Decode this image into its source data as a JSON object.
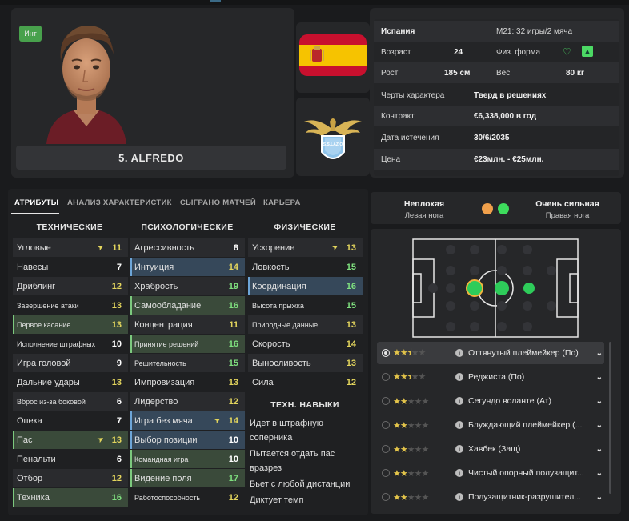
{
  "player": {
    "badge": "Инт",
    "name": "5. ALFREDO"
  },
  "info": {
    "nation": "Испания",
    "intl": "M21: 32 игры/2 мяча",
    "age_label": "Возраст",
    "age": "24",
    "form_label": "Физ. форма",
    "height_label": "Рост",
    "height": "185 см",
    "weight_label": "Вес",
    "weight": "80 кг",
    "traits_label": "Черты характера",
    "traits": "Тверд в решениях",
    "contract_label": "Контракт",
    "contract": "€6,338,000 в год",
    "expiry_label": "Дата истечения",
    "expiry": "30/6/2035",
    "value_label": "Цена",
    "value": "€23млн. - €25млн."
  },
  "club": {
    "crest_text": "S.S.LAZIO"
  },
  "tabs": [
    "АТРИБУТЫ",
    "АНАЛИЗ ХАРАКТЕРИСТИК",
    "СЫГРАНО МАТЧЕЙ",
    "КАРЬЕРА"
  ],
  "attributes": {
    "technical_title": "ТЕХНИЧЕСКИЕ",
    "mental_title": "ПСИХОЛОГИЧЕСКИЕ",
    "physical_title": "ФИЗИЧЕСКИЕ",
    "technical": [
      {
        "name": "Угловые",
        "value": "11"
      },
      {
        "name": "Навесы",
        "value": "7"
      },
      {
        "name": "Дриблинг",
        "value": "12"
      },
      {
        "name": "Завершение атаки",
        "value": "13"
      },
      {
        "name": "Первое касание",
        "value": "13"
      },
      {
        "name": "Исполнение штрафных",
        "value": "10"
      },
      {
        "name": "Игра головой",
        "value": "9"
      },
      {
        "name": "Дальние удары",
        "value": "13"
      },
      {
        "name": "Вброс из-за боковой",
        "value": "6"
      },
      {
        "name": "Опека",
        "value": "7"
      },
      {
        "name": "Пас",
        "value": "13"
      },
      {
        "name": "Пенальти",
        "value": "6"
      },
      {
        "name": "Отбор",
        "value": "12"
      },
      {
        "name": "Техника",
        "value": "16"
      }
    ],
    "mental": [
      {
        "name": "Агрессивность",
        "value": "8"
      },
      {
        "name": "Интуиция",
        "value": "14"
      },
      {
        "name": "Храбрость",
        "value": "19"
      },
      {
        "name": "Самообладание",
        "value": "16"
      },
      {
        "name": "Концентрация",
        "value": "11"
      },
      {
        "name": "Принятие решений",
        "value": "16"
      },
      {
        "name": "Решительность",
        "value": "15"
      },
      {
        "name": "Импровизация",
        "value": "13"
      },
      {
        "name": "Лидерство",
        "value": "12"
      },
      {
        "name": "Игра без мяча",
        "value": "14"
      },
      {
        "name": "Выбор позиции",
        "value": "10"
      },
      {
        "name": "Командная игра",
        "value": "10"
      },
      {
        "name": "Видение поля",
        "value": "17"
      },
      {
        "name": "Работоспособность",
        "value": "12"
      }
    ],
    "physical": [
      {
        "name": "Ускорение",
        "value": "13"
      },
      {
        "name": "Ловкость",
        "value": "15"
      },
      {
        "name": "Координация",
        "value": "16"
      },
      {
        "name": "Высота прыжка",
        "value": "15"
      },
      {
        "name": "Природные данные",
        "value": "13"
      },
      {
        "name": "Скорость",
        "value": "14"
      },
      {
        "name": "Выносливость",
        "value": "13"
      },
      {
        "name": "Сила",
        "value": "12"
      }
    ],
    "skills_title": "ТЕХН. НАВЫКИ",
    "skills": [
      "Идет в штрафную",
      "соперника",
      "Пытается отдать пас",
      "вразрез",
      "Бьет с любой дистанции",
      "Диктует темп"
    ]
  },
  "feet": {
    "left_rating": "Неплохая",
    "left_label": "Левая нога",
    "right_rating": "Очень сильная",
    "right_label": "Правая нога",
    "left_color": "#f0a04b",
    "right_color": "#3ddc5c"
  },
  "roles": [
    {
      "name": "Оттянутый плейм​ейкер (По)",
      "stars": 2.5,
      "selected": true
    },
    {
      "name": "Реджиста (По)",
      "stars": 2.5,
      "selected": false
    },
    {
      "name": "Сегундо воланте (Ат)",
      "stars": 2,
      "selected": false
    },
    {
      "name": "Блуждающий плеймейкер (...",
      "stars": 2,
      "selected": false
    },
    {
      "name": "Хавбек (Защ)",
      "stars": 2,
      "selected": false
    },
    {
      "name": "Чистый опорный полузащит...",
      "stars": 2,
      "selected": false
    },
    {
      "name": "Полузащитник-разрушител...",
      "stars": 2,
      "selected": false
    }
  ]
}
